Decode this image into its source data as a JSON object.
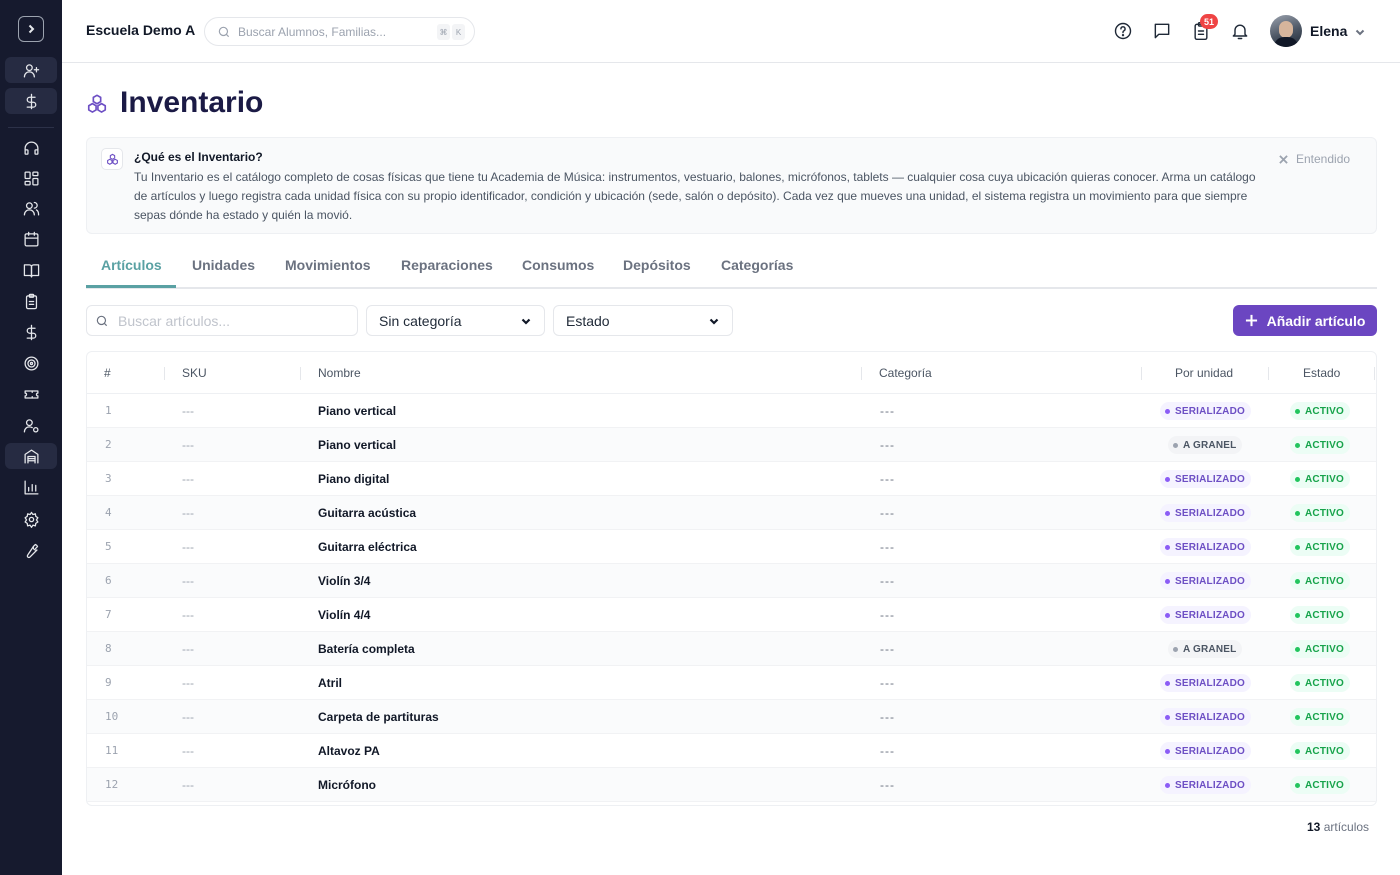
{
  "header": {
    "school": "Escuela Demo A",
    "search_placeholder": "Buscar Alumnos, Familias...",
    "kbd_mod": "⌘",
    "kbd_key": "K",
    "notif_count": "51",
    "user_name": "Elena"
  },
  "sidebar": {
    "items": [
      {
        "icon": "user-plus-icon"
      },
      {
        "icon": "dollar-icon"
      },
      {
        "icon": "headset-icon"
      },
      {
        "icon": "dashboard-icon"
      },
      {
        "icon": "users-icon"
      },
      {
        "icon": "calendar-icon"
      },
      {
        "icon": "book-icon"
      },
      {
        "icon": "clipboard-icon"
      },
      {
        "icon": "dollar-icon"
      },
      {
        "icon": "target-icon"
      },
      {
        "icon": "ticket-icon"
      },
      {
        "icon": "user-settings-icon"
      },
      {
        "icon": "inventory-icon"
      },
      {
        "icon": "chart-icon"
      },
      {
        "icon": "gear-icon"
      },
      {
        "icon": "wrench-icon"
      }
    ]
  },
  "page": {
    "title": "Inventario"
  },
  "info": {
    "title": "¿Qué es el Inventario?",
    "text": "Tu Inventario es el catálogo completo de cosas físicas que tiene tu Academia de Música: instrumentos, vestuario, balones, micrófonos, tablets — cualquier cosa cuya ubicación quieras conocer. Arma un catálogo de artículos y luego registra cada unidad física con su propio identificador, condición y ubicación (sede, salón o depósito). Cada vez que mueves una unidad, el sistema registra un movimiento para que siempre sepas dónde ha estado y quién la movió.",
    "dismiss": "Entendido"
  },
  "tabs": [
    "Artículos",
    "Unidades",
    "Movimientos",
    "Reparaciones",
    "Consumos",
    "Depósitos",
    "Categorías"
  ],
  "filters": {
    "search_placeholder": "Buscar artículos...",
    "category": "Sin categoría",
    "status": "Estado",
    "add_label": "Añadir artículo"
  },
  "table": {
    "columns": [
      "#",
      "SKU",
      "Nombre",
      "Categoría",
      "Por unidad",
      "Estado"
    ],
    "rows": [
      {
        "num": "1",
        "sku": "---",
        "name": "Piano vertical",
        "category": "---",
        "unit": "SERIALIZADO",
        "status": "ACTIVO"
      },
      {
        "num": "2",
        "sku": "---",
        "name": "Piano vertical",
        "category": "---",
        "unit": "A GRANEL",
        "status": "ACTIVO"
      },
      {
        "num": "3",
        "sku": "---",
        "name": "Piano digital",
        "category": "---",
        "unit": "SERIALIZADO",
        "status": "ACTIVO"
      },
      {
        "num": "4",
        "sku": "---",
        "name": "Guitarra acústica",
        "category": "---",
        "unit": "SERIALIZADO",
        "status": "ACTIVO"
      },
      {
        "num": "5",
        "sku": "---",
        "name": "Guitarra eléctrica",
        "category": "---",
        "unit": "SERIALIZADO",
        "status": "ACTIVO"
      },
      {
        "num": "6",
        "sku": "---",
        "name": "Violín 3/4",
        "category": "---",
        "unit": "SERIALIZADO",
        "status": "ACTIVO"
      },
      {
        "num": "7",
        "sku": "---",
        "name": "Violín 4/4",
        "category": "---",
        "unit": "SERIALIZADO",
        "status": "ACTIVO"
      },
      {
        "num": "8",
        "sku": "---",
        "name": "Batería completa",
        "category": "---",
        "unit": "A GRANEL",
        "status": "ACTIVO"
      },
      {
        "num": "9",
        "sku": "---",
        "name": "Atril",
        "category": "---",
        "unit": "SERIALIZADO",
        "status": "ACTIVO"
      },
      {
        "num": "10",
        "sku": "---",
        "name": "Carpeta de partituras",
        "category": "---",
        "unit": "SERIALIZADO",
        "status": "ACTIVO"
      },
      {
        "num": "11",
        "sku": "---",
        "name": "Altavoz PA",
        "category": "---",
        "unit": "SERIALIZADO",
        "status": "ACTIVO"
      },
      {
        "num": "12",
        "sku": "---",
        "name": "Micrófono",
        "category": "---",
        "unit": "SERIALIZADO",
        "status": "ACTIVO"
      }
    ]
  },
  "footer": {
    "count": "13",
    "count_label": "artículos"
  },
  "colors": {
    "accent": "#6b46c1",
    "tab_active": "#5aa1a3",
    "sidebar_bg": "#161a2e",
    "title": "#1b1a45"
  }
}
